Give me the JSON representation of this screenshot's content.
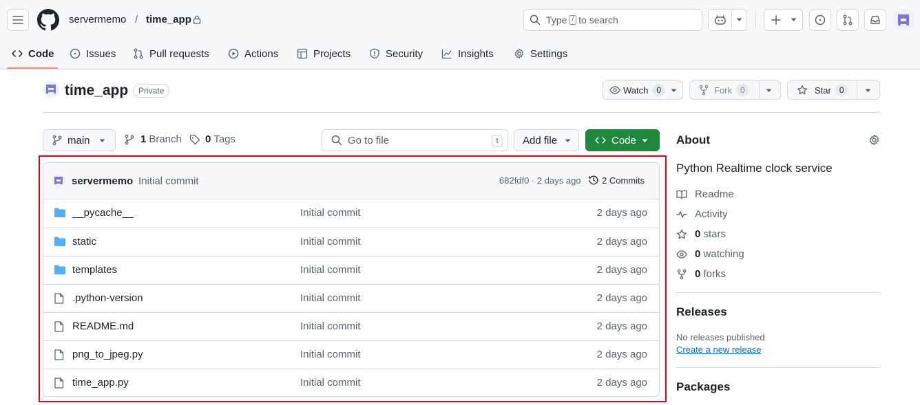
{
  "header": {
    "owner": "servermemo",
    "separator": "/",
    "repo": "time_app",
    "search_prefix": "Type",
    "search_key": "/",
    "search_suffix": "to search"
  },
  "nav": {
    "tabs": [
      {
        "label": "Code"
      },
      {
        "label": "Issues"
      },
      {
        "label": "Pull requests"
      },
      {
        "label": "Actions"
      },
      {
        "label": "Projects"
      },
      {
        "label": "Security"
      },
      {
        "label": "Insights"
      },
      {
        "label": "Settings"
      }
    ]
  },
  "repo": {
    "name": "time_app",
    "visibility": "Private",
    "watch_label": "Watch",
    "watch_count": "0",
    "fork_label": "Fork",
    "fork_count": "0",
    "star_label": "Star",
    "star_count": "0"
  },
  "toolbar": {
    "branch": "main",
    "branch_count": "1",
    "branch_label": "Branch",
    "tag_count": "0",
    "tag_label": "Tags",
    "goto_placeholder": "Go to file",
    "goto_key": "t",
    "add_file_label": "Add file",
    "code_label": "Code"
  },
  "commit": {
    "author": "servermemo",
    "message": "Initial commit",
    "meta": "682fdf0 · 2 days ago",
    "commits_label": "2 Commits"
  },
  "files": [
    {
      "type": "folder",
      "name": "__pycache__",
      "message": "Initial commit",
      "date": "2 days ago"
    },
    {
      "type": "folder",
      "name": "static",
      "message": "Initial commit",
      "date": "2 days ago"
    },
    {
      "type": "folder",
      "name": "templates",
      "message": "Initial commit",
      "date": "2 days ago"
    },
    {
      "type": "file",
      "name": ".python-version",
      "message": "Initial commit",
      "date": "2 days ago"
    },
    {
      "type": "file",
      "name": "README.md",
      "message": "Initial commit",
      "date": "2 days ago"
    },
    {
      "type": "file",
      "name": "png_to_jpeg.py",
      "message": "Initial commit",
      "date": "2 days ago"
    },
    {
      "type": "file",
      "name": "time_app.py",
      "message": "Initial commit",
      "date": "2 days ago"
    }
  ],
  "about": {
    "title": "About",
    "description": "Python Realtime clock service",
    "readme": "Readme",
    "activity": "Activity",
    "stars_count": "0",
    "stars_label": "stars",
    "watching_count": "0",
    "watching_label": "watching",
    "forks_count": "0",
    "forks_label": "forks"
  },
  "releases": {
    "title": "Releases",
    "empty": "No releases published",
    "create_link": "Create a new release"
  },
  "packages": {
    "title": "Packages"
  },
  "colors": {
    "accent_green": "#1f883d",
    "link_blue": "#0969da",
    "folder_blue": "#54aeff",
    "tab_underline": "#fd8c73",
    "highlight_red": "#e0001b"
  }
}
